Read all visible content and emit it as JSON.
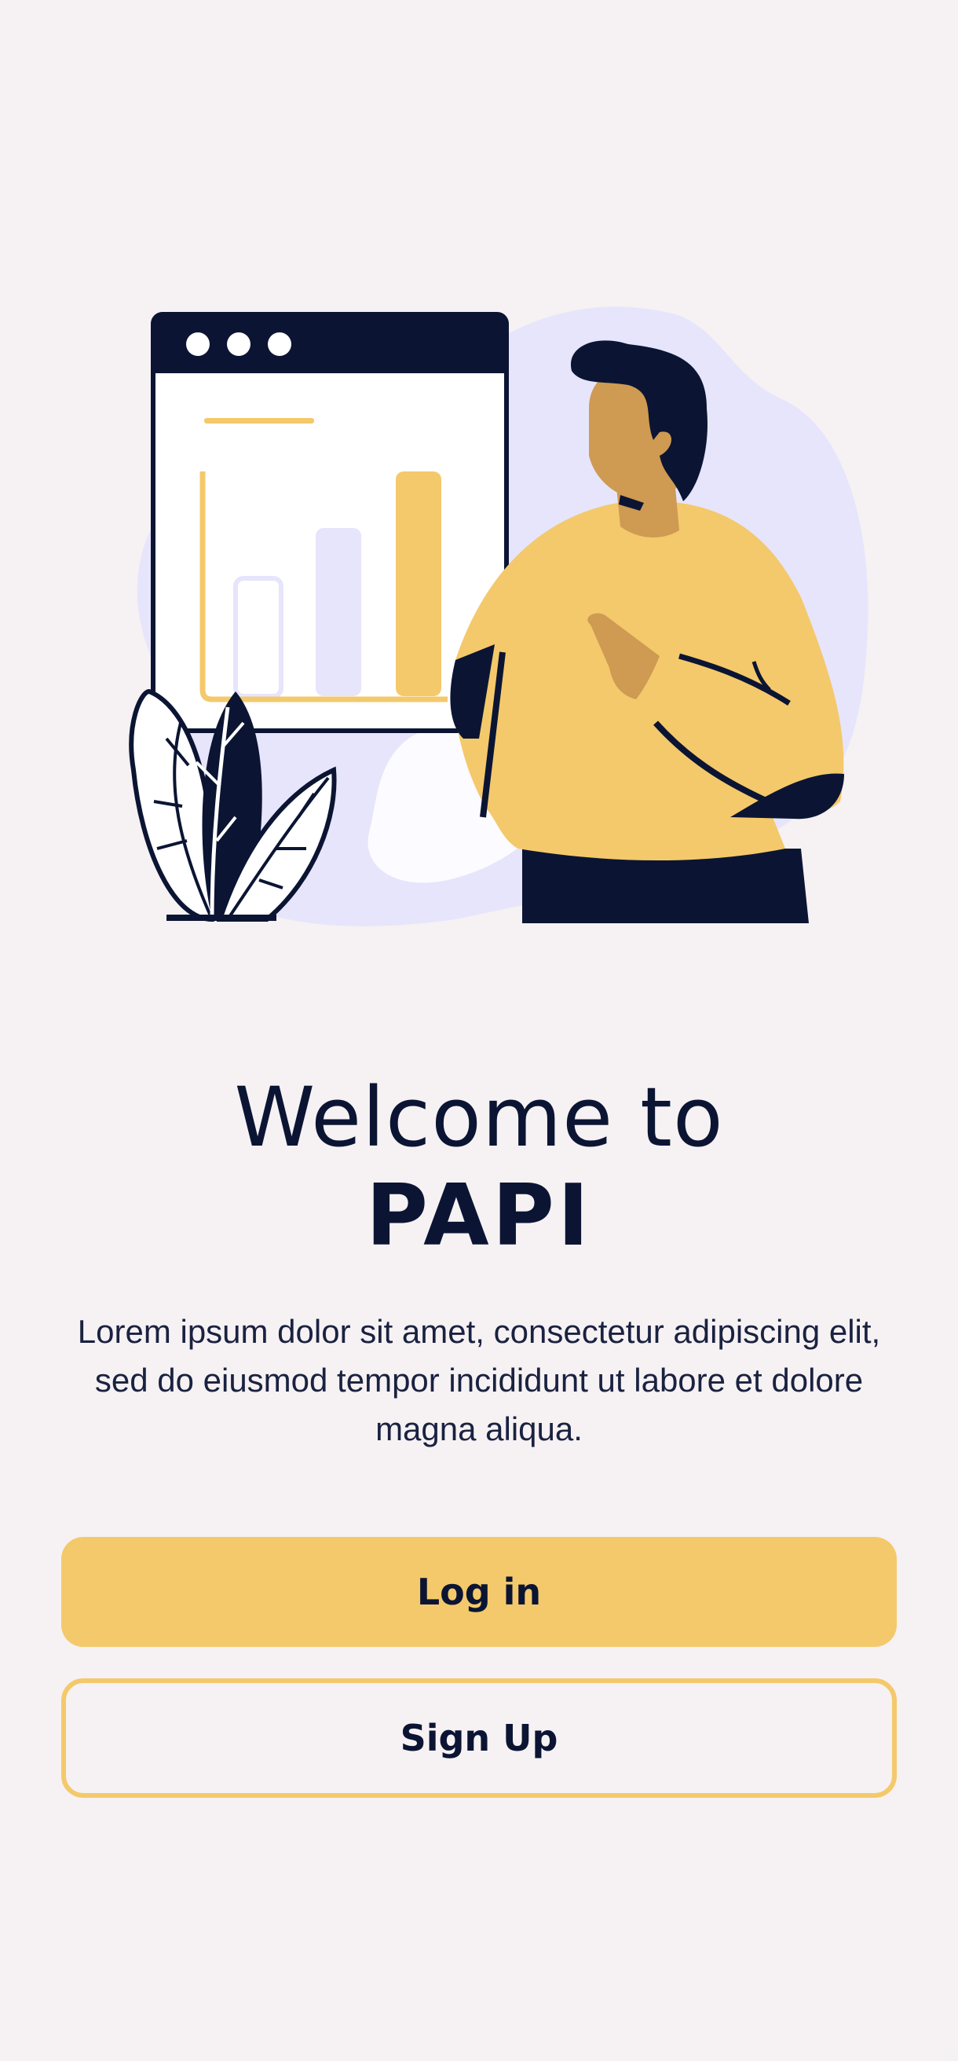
{
  "welcome": {
    "line1": "Welcome to",
    "brand": "PAPI"
  },
  "description": "Lorem ipsum dolor sit amet, consectetur adipiscing elit, sed do eiusmod tempor incididunt ut labore et dolore magna aliqua.",
  "buttons": {
    "login_label": "Log in",
    "signup_label": "Sign Up"
  },
  "colors": {
    "background": "#f6f1f3",
    "accent": "#f4c96b",
    "navy": "#0b1533",
    "lavender": "#e6e5fb",
    "skin": "#cf9a52"
  },
  "illustration": {
    "icon": "presentation-illustration"
  }
}
